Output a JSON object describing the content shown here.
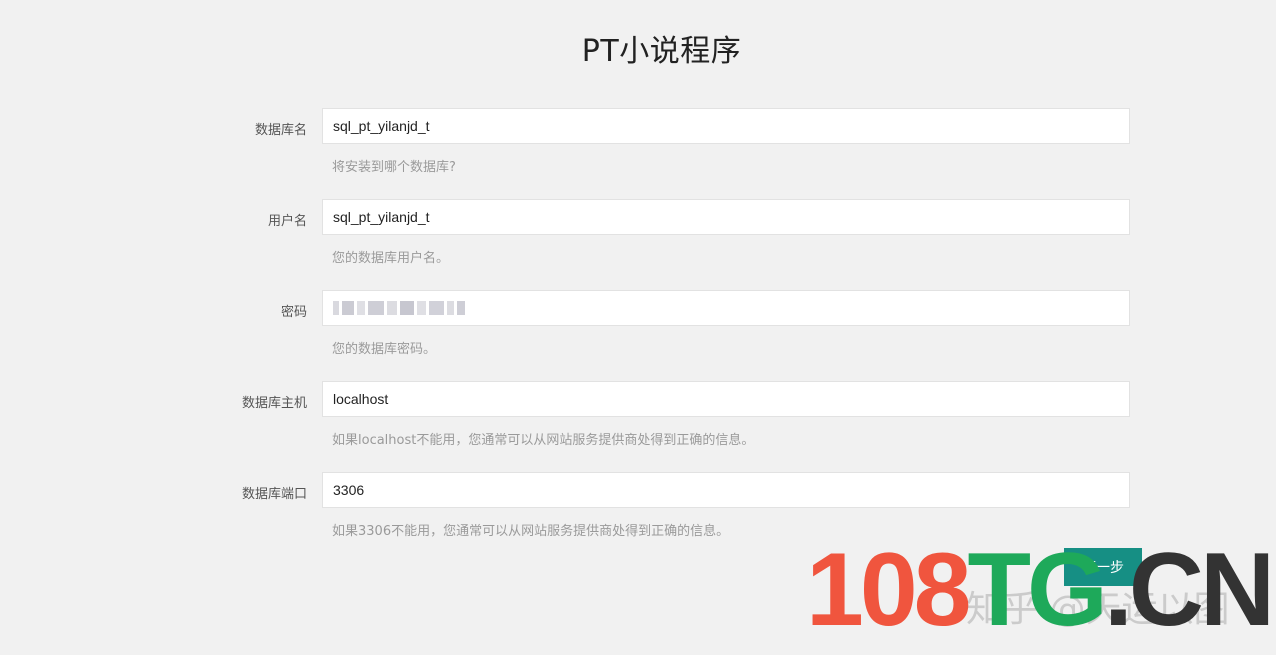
{
  "page": {
    "title": "PT小说程序"
  },
  "form": {
    "fields": [
      {
        "label": "数据库名",
        "value": "sql_pt_yilanjd_t",
        "help": "将安装到哪个数据库?"
      },
      {
        "label": "用户名",
        "value": "sql_pt_yilanjd_t",
        "help": "您的数据库用户名。"
      },
      {
        "label": "密码",
        "value": "",
        "help": "您的数据库密码。"
      },
      {
        "label": "数据库主机",
        "value": "localhost",
        "help": "如果localhost不能用，您通常可以从网站服务提供商处得到正确的信息。"
      },
      {
        "label": "数据库端口",
        "value": "3306",
        "help": "如果3306不能用，您通常可以从网站服务提供商处得到正确的信息。"
      }
    ],
    "next_label": "下一步"
  },
  "watermark": {
    "site_part1": "108",
    "site_part2": "TG",
    "site_part3": ".CN",
    "zhihu_text": "知乎 @天运以图"
  },
  "colors": {
    "background": "#f1f1f1",
    "button": "#168f84",
    "watermark_red": "#f0553e",
    "watermark_green": "#1ea95a",
    "watermark_dark": "#333333"
  }
}
